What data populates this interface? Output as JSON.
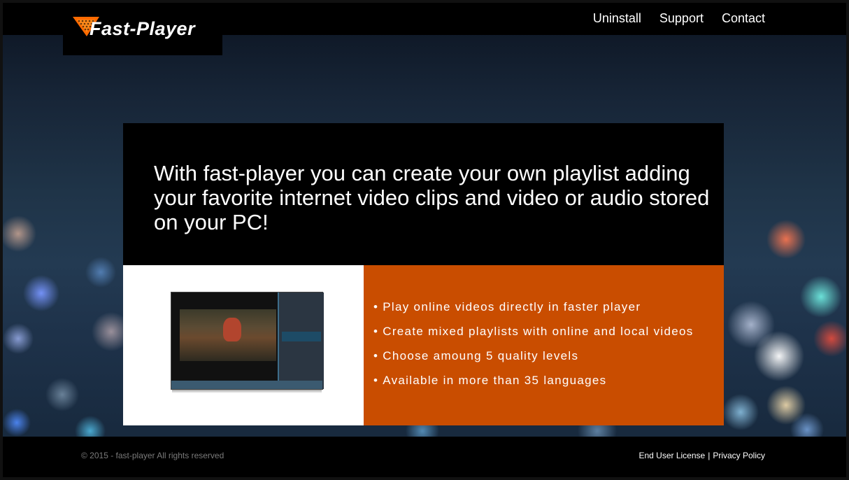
{
  "brand": {
    "logo_text": "Fast-Player"
  },
  "nav": {
    "items": [
      {
        "label": "Uninstall"
      },
      {
        "label": "Support"
      },
      {
        "label": "Contact"
      }
    ]
  },
  "hero": {
    "headline": "With fast-player you can create your own playlist adding your favorite internet video clips and video or audio stored on your PC!"
  },
  "features": {
    "items": [
      "Play online videos directly in faster player",
      "Create mixed playlists with online and local videos",
      "Choose amoung 5 quality levels",
      "Available in more than 35 languages"
    ],
    "bullet": "•"
  },
  "footer": {
    "copyright": "© 2015 - fast-player All rights reserved",
    "links": [
      {
        "label": "End User License"
      },
      {
        "label": "Privacy Policy"
      }
    ],
    "separator": "|"
  },
  "colors": {
    "accent_orange": "#c94d00",
    "header_bg": "#000000",
    "logo_orange": "#ff6a00"
  },
  "icons": {
    "logo": "fast-player-triangle-logo"
  }
}
